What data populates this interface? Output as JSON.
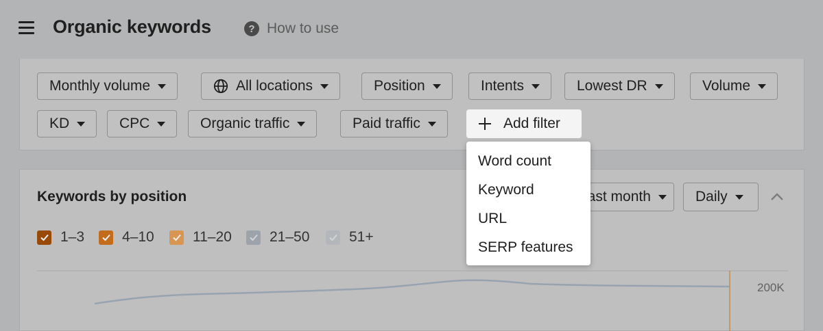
{
  "header": {
    "title": "Organic keywords",
    "help_label": "How to use"
  },
  "filters": {
    "row1": [
      "Monthly volume",
      "All locations",
      "Position",
      "Intents",
      "Lowest DR",
      "Volume"
    ],
    "row2": [
      "KD",
      "CPC",
      "Organic traffic",
      "Paid traffic"
    ],
    "add_filter_label": "Add filter"
  },
  "add_filter_menu": {
    "items": [
      "Word count",
      "Keyword",
      "URL",
      "SERP features"
    ]
  },
  "keywords_by_position": {
    "title": "Keywords by position",
    "period_label": "Last month",
    "granularity_label": "Daily",
    "position_ranges": [
      {
        "label": "1–3",
        "checked": true,
        "color": "#9a4a07"
      },
      {
        "label": "4–10",
        "checked": true,
        "color": "#c36c1b"
      },
      {
        "label": "11–20",
        "checked": true,
        "color": "#d99552"
      },
      {
        "label": "21–50",
        "checked": true,
        "color": "#9ca3ab"
      },
      {
        "label": "51+",
        "checked": true,
        "color": "#b3b7bc"
      }
    ],
    "chart": {
      "y_axis_label": "200K"
    }
  },
  "colors": {
    "overlay": "#b3b4b5",
    "panel": "#bfbfbf",
    "menu_bg": "#ffffff",
    "line_series": "#97a3b1",
    "marker": "#c78a4b"
  }
}
